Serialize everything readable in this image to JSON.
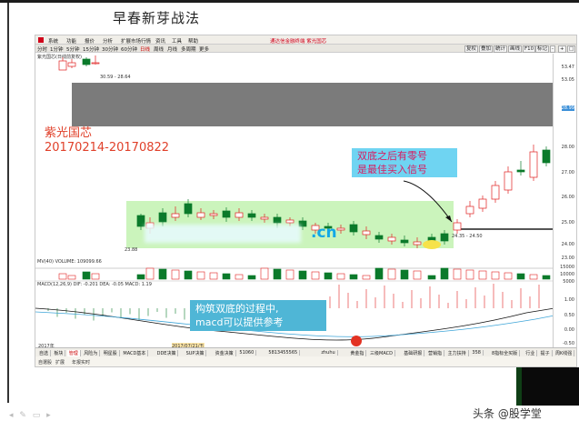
{
  "slide": {
    "title": "早春新芽战法",
    "watermark": "头条 @股学堂"
  },
  "app": {
    "menu": [
      "系统",
      "功能",
      "报价",
      "分析",
      "扩展市场行情",
      "资讯",
      "工具",
      "帮助"
    ],
    "center_title": "通达信金融终端 紫光国芯",
    "toolbar": [
      "分时",
      "1分钟",
      "5分钟",
      "15分钟",
      "30分钟",
      "60分钟",
      "日线",
      "周线",
      "月线",
      "多周期",
      "更多"
    ],
    "toolbar_selected": "日线",
    "right_buttons": [
      "复权",
      "叠加",
      "统计",
      "画线",
      "F10",
      "标记",
      "-",
      "+",
      "□"
    ],
    "stock_line": "紫光国芯(日线前复权)"
  },
  "annotations": {
    "stock_name": "紫光国芯",
    "date_range": "20170214-20170822",
    "signal_line1": "双底之后有零号",
    "signal_line2": "是最佳买入信号",
    "macd_line1": "构筑双底的过程中,",
    "macd_line2": "macd可以提供参考",
    "watermark_text": ".cn"
  },
  "chart_labels": {
    "high_label": "30.59 - 28.64",
    "low_label": "23.88",
    "range_label": "24.35 - 24.50",
    "vol_label": "MV(40)  VOLUME: 109099.66",
    "macd_label": "MACD(12,26,9)  DIF: -0.201  DEA: -0.05  MACD: 1.19",
    "bottom_left": "2017年",
    "bottom_date": "2017/07/21/五",
    "vol_axis": [
      "15000",
      "10000",
      "5000"
    ],
    "price_axis": [
      "53.47",
      "53.05",
      "28.99",
      "28.00",
      "27.00",
      "26.00",
      "25.00",
      "24.00",
      "23.00"
    ],
    "macd_axis": [
      "1.00",
      "0.50",
      "0.00",
      "-0.50"
    ]
  },
  "tabs": [
    "自选",
    "板块",
    "管理",
    "风险为",
    "明星股",
    "MACD基本",
    "DDE决策",
    "SUP决策",
    "资金决策",
    "51060",
    "5813455565",
    "zhuhu",
    "黄金指",
    "三级MACD",
    "基础研报",
    "营销指",
    "主力扶持",
    "358",
    "8指标全买版",
    "行业",
    "提子",
    "周K线强",
    "箭楼"
  ],
  "tab_selected": "管理",
  "status": [
    "自選股",
    "扩展",
    "年报实时"
  ],
  "colors": {
    "up": "#e02020",
    "down": "#0b7a2b",
    "accent_blue": "#6fd4f2",
    "annot_red": "#e0402a"
  }
}
